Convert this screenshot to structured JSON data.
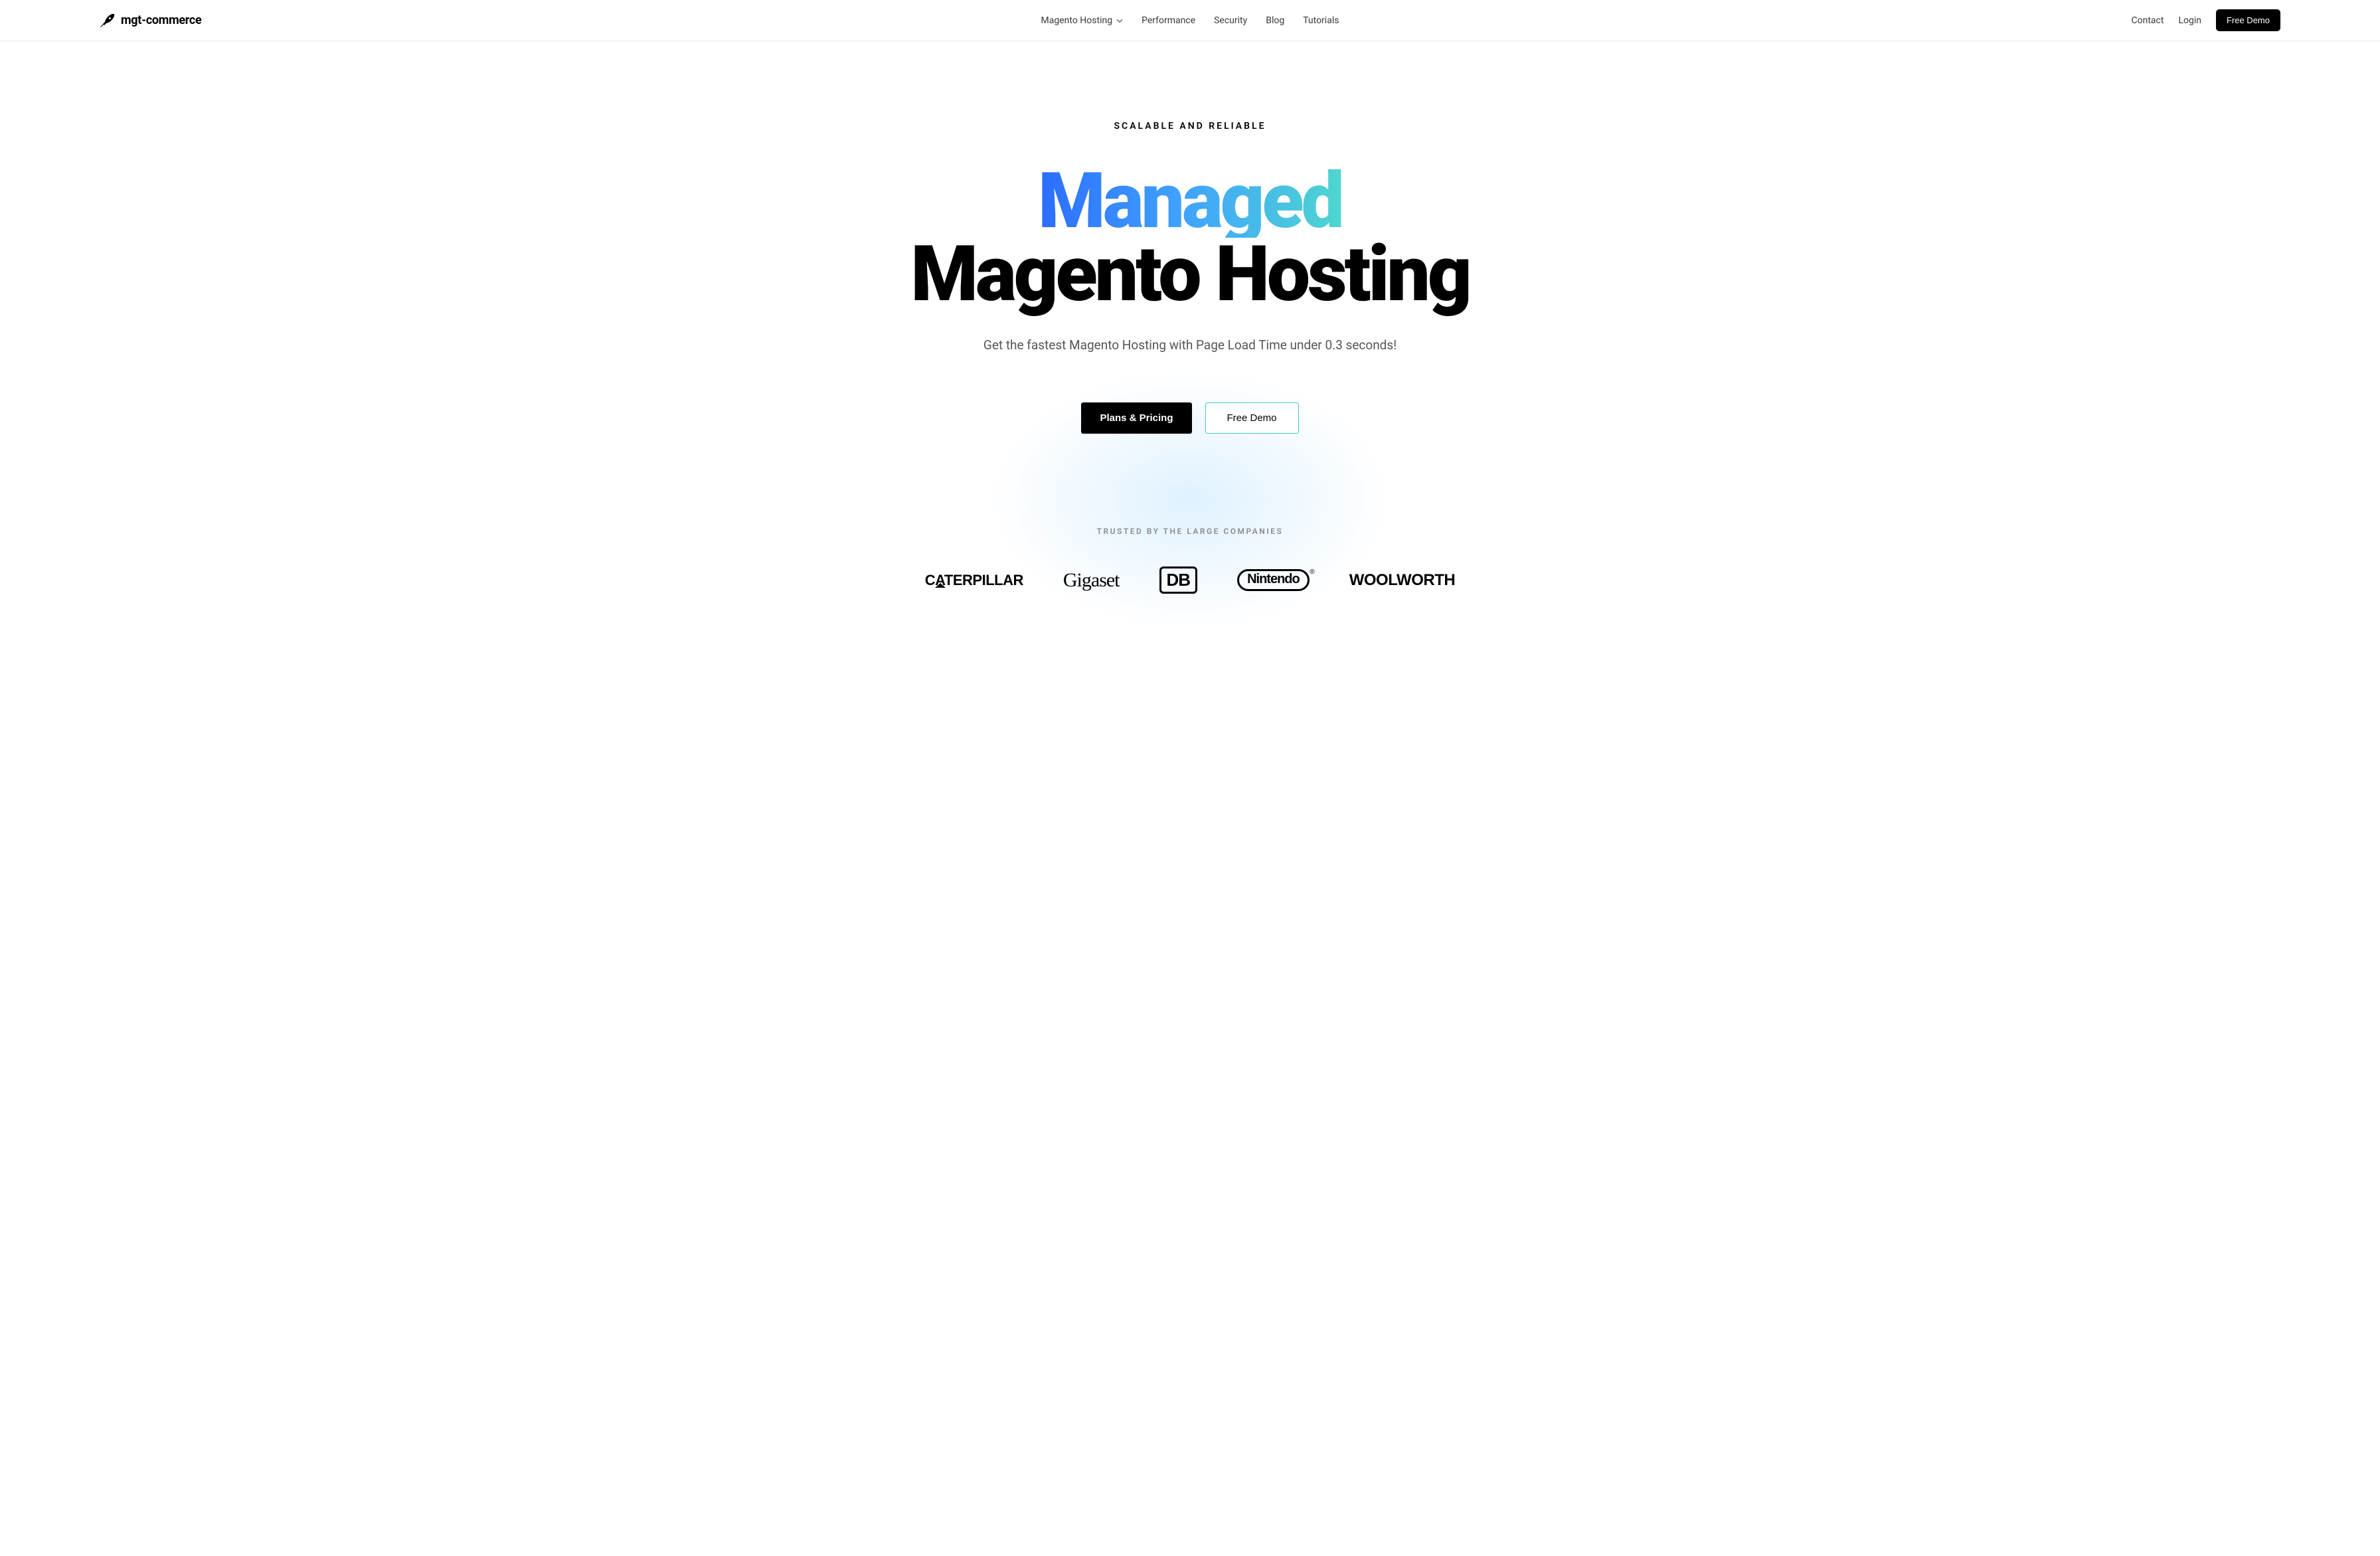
{
  "logo": {
    "text": "mgt-commerce"
  },
  "nav": {
    "items": [
      {
        "label": "Magento Hosting",
        "has_dropdown": true
      },
      {
        "label": "Performance",
        "has_dropdown": false
      },
      {
        "label": "Security",
        "has_dropdown": false
      },
      {
        "label": "Blog",
        "has_dropdown": false
      },
      {
        "label": "Tutorials",
        "has_dropdown": false
      }
    ]
  },
  "right_nav": {
    "contact": "Contact",
    "login": "Login",
    "free_demo": "Free Demo"
  },
  "hero": {
    "eyebrow": "SCALABLE AND RELIABLE",
    "title_managed": "Managed",
    "title_rest": "Magento Hosting",
    "subtitle": "Get the fastest Magento Hosting with Page Load Time under 0.3 seconds!",
    "cta_primary": "Plans & Pricing",
    "cta_secondary": "Free Demo"
  },
  "logos": {
    "eyebrow": "TRUSTED BY THE LARGE COMPANIES",
    "companies": [
      {
        "name": "CATERPILLAR"
      },
      {
        "name": "Gigaset"
      },
      {
        "name": "DB"
      },
      {
        "name": "Nintendo"
      },
      {
        "name": "WOOLWORTH"
      }
    ]
  }
}
